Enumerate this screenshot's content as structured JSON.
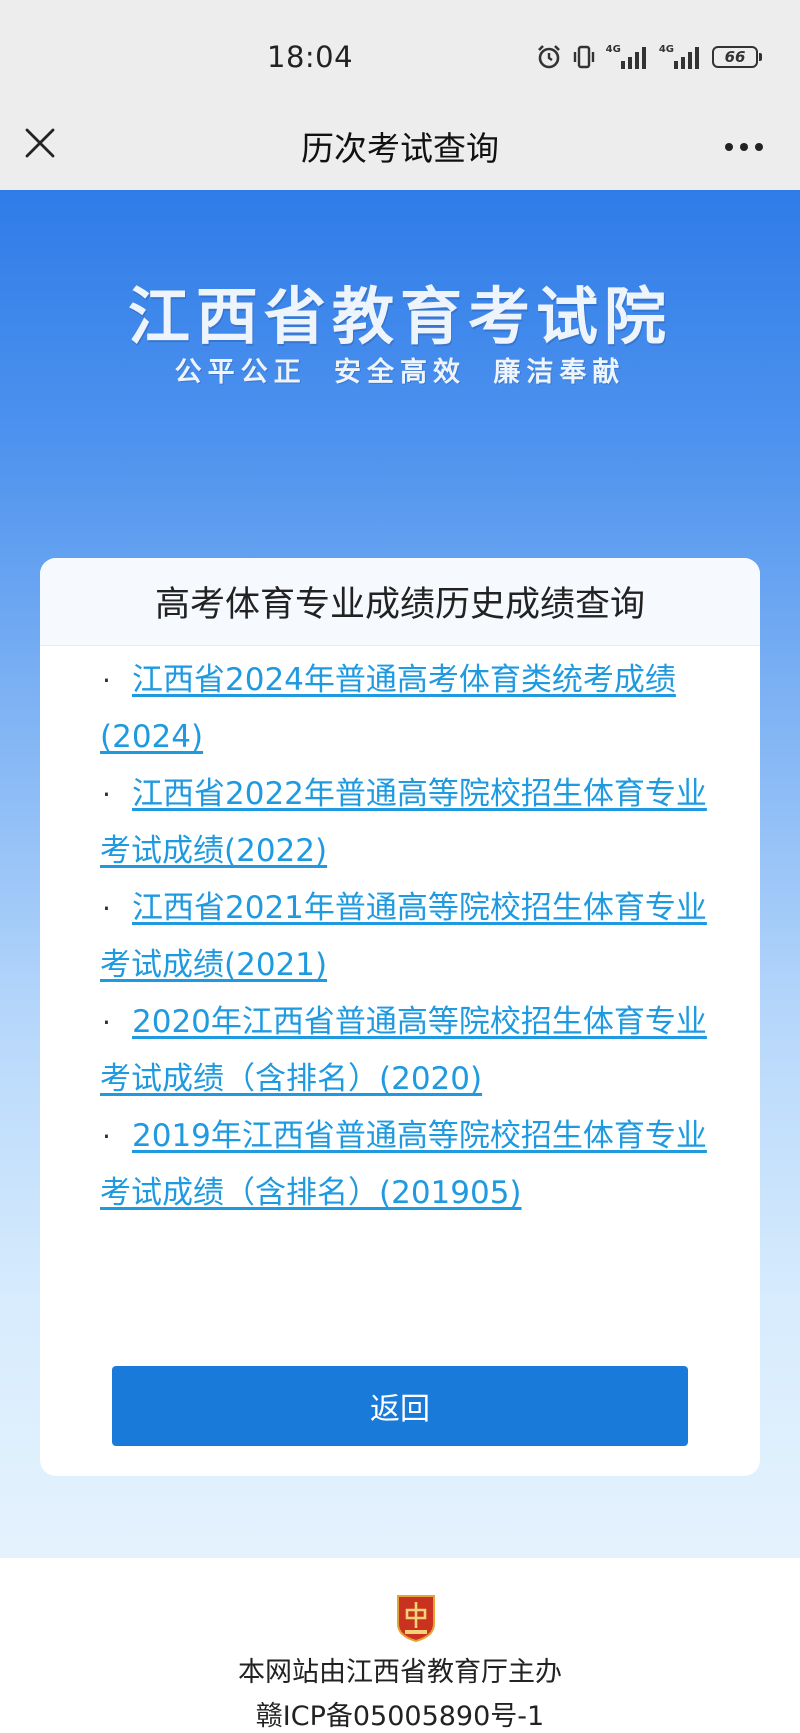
{
  "status_bar": {
    "time": "18:04",
    "network_1": "4G",
    "network_2": "4G",
    "battery": "66",
    "icons": [
      "alarm-icon",
      "vibrate-icon",
      "signal-icon",
      "signal-icon",
      "battery-icon"
    ]
  },
  "nav": {
    "title": "历次考试查询",
    "close_icon": "close-icon",
    "more_icon": "more-icon"
  },
  "hero": {
    "title": "江西省教育考试院",
    "slogan": "公平公正 安全高效 廉洁奉献"
  },
  "card": {
    "title": "高考体育专业成绩历史成绩查询",
    "bullet": "·",
    "items": [
      {
        "label": "江西省2024年普通高考体育类统考成绩(2024)"
      },
      {
        "label": "江西省2022年普通高等院校招生体育专业考试成绩(2022)"
      },
      {
        "label": "江西省2021年普通高等院校招生体育专业考试成绩(2021)"
      },
      {
        "label": "2020年江西省普通高等院校招生体育专业考试成绩（含排名）(2020)"
      },
      {
        "label": "2019年江西省普通高等院校招生体育专业考试成绩（含排名）(201905)"
      }
    ],
    "back_label": "返回"
  },
  "footer": {
    "emblem_icon": "government-emblem-icon",
    "line1": "本网站由江西省教育厅主办",
    "line2": "赣ICP备05005890号-1"
  },
  "colors": {
    "accent_link": "#1f9ae0",
    "button": "#1a7ad9",
    "hero_top": "#2f7ce8",
    "hero_bottom": "#e4f2fd"
  }
}
